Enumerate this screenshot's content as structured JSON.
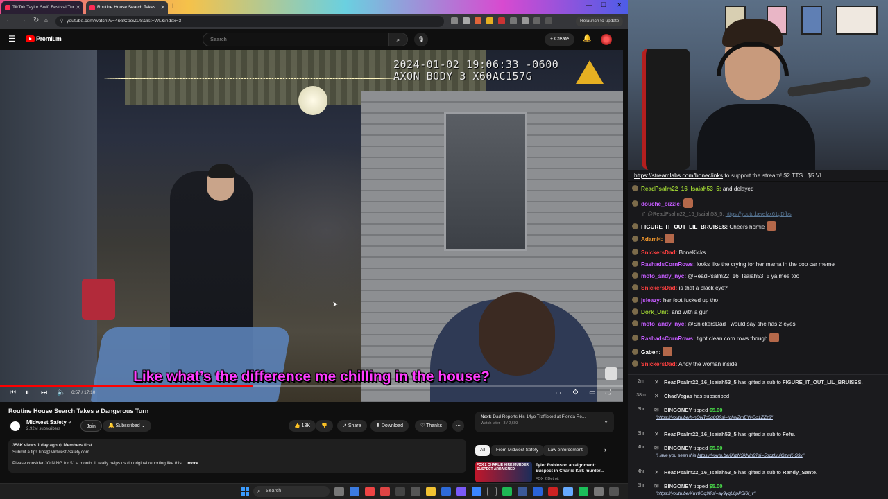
{
  "browser": {
    "tabs": [
      {
        "label": "TikTok Taylor Swift Festival Tur"
      },
      {
        "label": "Routine House Search Takes"
      }
    ],
    "url": "youtube.com/watch?v=4rx8CpeiZU8&list=WL&index=3",
    "relaunch_label": "Relaunch to update"
  },
  "youtube": {
    "brand": "Premium",
    "search_placeholder": "Search",
    "create_label": "Create"
  },
  "player": {
    "timestamp_line1": "2024-01-02 19:06:33 -0600",
    "timestamp_line2": "AXON BODY 3 X60AC157G",
    "subtitle": "Like what’s the difference me chilling in the house?",
    "time": "6:57 / 17:10",
    "progress": 0.405
  },
  "video": {
    "title": "Routine House Search Takes a Dangerous Turn",
    "channel": "Midwest Safety",
    "subscribers": "2.92M subscribers",
    "join_label": "Join",
    "subscribed_label": "Subscribed",
    "likes": "13K",
    "share_label": "Share",
    "download_label": "Download",
    "thanks_label": "Thanks",
    "desc_line1": "358K views  1 day ago  ⊙ Members first",
    "desc_line2": "Submit a tip! Tips@Midwest-Safety.com",
    "desc_line3": "Please consider JOINING for $1 a month. It really helps us do original reporting like this.",
    "more_label": "...more"
  },
  "up_next": {
    "label": "Next:",
    "title": "Dad Reports His 14yo Trafficked at Florida Re...",
    "sub": "Watch later - 3 / 2,603"
  },
  "chips": [
    "All",
    "From Midwest Safety",
    "Law enforcement"
  ],
  "recommendation": {
    "thumb_text": "FOX 2  CHARLIE KIRK MURDER SUSPECT ARRAIGNED",
    "title": "Tyler Robinson arraignment: Suspect in Charlie Kirk murder...",
    "channel": "FOX 2 Detroit"
  },
  "chat": {
    "banner_link": "https://streamlabs.com/boneclinks",
    "banner_text": "to support the stream! $2 TTS | $5 VI...",
    "messages": [
      {
        "user": "ReadPsalm22_16_Isaiah53_5:",
        "text": "and delayed",
        "color": "#9acd32"
      },
      {
        "user": "douche_bizzle:",
        "text": "",
        "color": "#c55cff",
        "emote": true
      },
      {
        "reply": "@ReadPsalm22_16_Isaiah53_5:",
        "reply_link": "https://youtu.be/efzx61gDfbs"
      },
      {
        "user": "FIGURE_IT_OUT_LIL_BRUISES:",
        "text": "Cheers homie",
        "color": "#ffffff",
        "emote": true
      },
      {
        "user": "AdamH:",
        "text": "",
        "color": "#ff9f2e",
        "emote": true
      },
      {
        "user": "SnickersDad:",
        "text": "BoneKicks",
        "color": "#ff4040"
      },
      {
        "user": "RashadsCornRows:",
        "text": "looks like the crying for her mama in the cop car meme",
        "color": "#c55cff"
      },
      {
        "user": "moto_andy_nyc:",
        "text": "@ReadPsalm22_16_Isaiah53_5 ya mee too",
        "color": "#c55cff"
      },
      {
        "user": "SnickersDad:",
        "text": "is that a black eye?",
        "color": "#ff4040"
      },
      {
        "user": "jsleazy:",
        "text": "her foot fucked up tho",
        "color": "#c55cff"
      },
      {
        "user": "Dork_Unit:",
        "text": "and with a gun",
        "color": "#9acd32"
      },
      {
        "user": "moto_andy_nyc:",
        "text": "@SnickersDad I would say she has 2 eyes",
        "color": "#c55cff"
      },
      {
        "user": "RashadsCornRows:",
        "text": "tight clean corn rows though",
        "color": "#c55cff",
        "emote": true
      },
      {
        "user": "Gaben:",
        "text": "",
        "color": "#ffffff",
        "emote": true
      },
      {
        "user": "SnickersDad:",
        "text": "Andy the woman inside",
        "color": "#ff4040"
      }
    ]
  },
  "events": [
    {
      "age": "2m",
      "name": "ReadPsalm22_16_Isaiah53_5",
      "action": "has gifted a sub to",
      "target": "FIGURE_IT_OUT_LIL_BRUISES."
    },
    {
      "age": "38m",
      "name": "ChadVegas",
      "action": "has subscribed",
      "target": ""
    },
    {
      "age": "3hr",
      "name": "BINGONEY",
      "action": "tipped",
      "amount": "$5.00",
      "quote": "\"https://youtu.be/h-nONTc3g0Q?si=tqhwZmEYvOo1ZZz8\""
    },
    {
      "age": "3hr",
      "name": "ReadPsalm22_16_Isaiah53_5",
      "action": "has gifted a sub to",
      "target": "Fefu."
    },
    {
      "age": "4hr",
      "name": "BINGONEY",
      "action": "tipped",
      "amount": "$5.00",
      "quote_prefix": "\"Have you seen this ",
      "quote_link": "https://youtu.be/jXlzNSkNln8?si=5oqzIxuiGzwK-S9x",
      "quote_suffix": "\""
    },
    {
      "age": "4hr",
      "name": "ReadPsalm22_16_Isaiah53_5",
      "action": "has gifted a sub to",
      "target": "Randy_Sante."
    },
    {
      "age": "5hr",
      "name": "BINGONEY",
      "action": "tipped",
      "amount": "$5.00",
      "quote": "\"https://youtu.be/Xuv0Oq9l?si=ay9yqL6pPBi6f_v\""
    }
  ],
  "taskbar": {
    "search_label": "Search"
  },
  "colors": {
    "accent": "#ff0000",
    "subtitle": "#ff3cff",
    "tip": "#4be04b"
  }
}
